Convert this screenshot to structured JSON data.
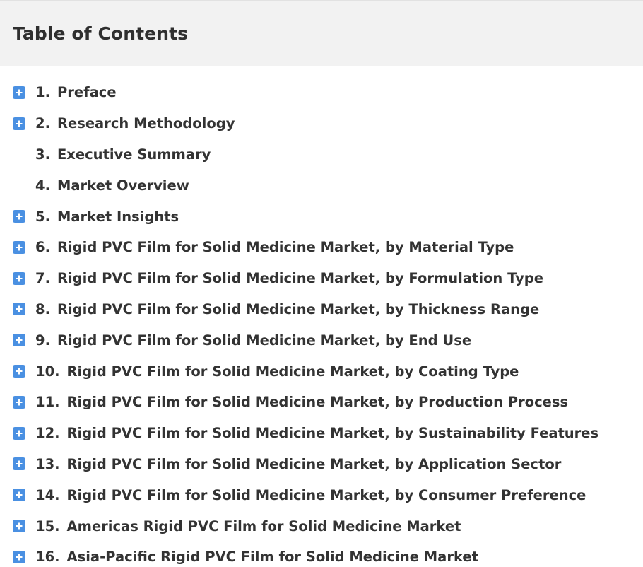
{
  "header": {
    "title": "Table of Contents"
  },
  "toc": {
    "items": [
      {
        "number": "1.",
        "label": "Preface",
        "expandable": true
      },
      {
        "number": "2.",
        "label": "Research Methodology",
        "expandable": true
      },
      {
        "number": "3.",
        "label": "Executive Summary",
        "expandable": false
      },
      {
        "number": "4.",
        "label": "Market Overview",
        "expandable": false
      },
      {
        "number": "5.",
        "label": "Market Insights",
        "expandable": true
      },
      {
        "number": "6.",
        "label": "Rigid PVC Film for Solid Medicine Market, by Material Type",
        "expandable": true
      },
      {
        "number": "7.",
        "label": "Rigid PVC Film for Solid Medicine Market, by Formulation Type",
        "expandable": true
      },
      {
        "number": "8.",
        "label": "Rigid PVC Film for Solid Medicine Market, by Thickness Range",
        "expandable": true
      },
      {
        "number": "9.",
        "label": "Rigid PVC Film for Solid Medicine Market, by End Use",
        "expandable": true
      },
      {
        "number": "10.",
        "label": "Rigid PVC Film for Solid Medicine Market, by Coating Type",
        "expandable": true
      },
      {
        "number": "11.",
        "label": "Rigid PVC Film for Solid Medicine Market, by Production Process",
        "expandable": true
      },
      {
        "number": "12.",
        "label": "Rigid PVC Film for Solid Medicine Market, by Sustainability Features",
        "expandable": true
      },
      {
        "number": "13.",
        "label": "Rigid PVC Film for Solid Medicine Market, by Application Sector",
        "expandable": true
      },
      {
        "number": "14.",
        "label": "Rigid PVC Film for Solid Medicine Market, by Consumer Preference",
        "expandable": true
      },
      {
        "number": "15.",
        "label": "Americas Rigid PVC Film for Solid Medicine Market",
        "expandable": true
      },
      {
        "number": "16.",
        "label": "Asia-Pacific Rigid PVC Film for Solid Medicine Market",
        "expandable": true
      }
    ]
  },
  "icons": {
    "expand": "plus-square-icon"
  },
  "colors": {
    "accent": "#4a90e2",
    "header_bg": "#f2f2f2",
    "text": "#333333"
  }
}
